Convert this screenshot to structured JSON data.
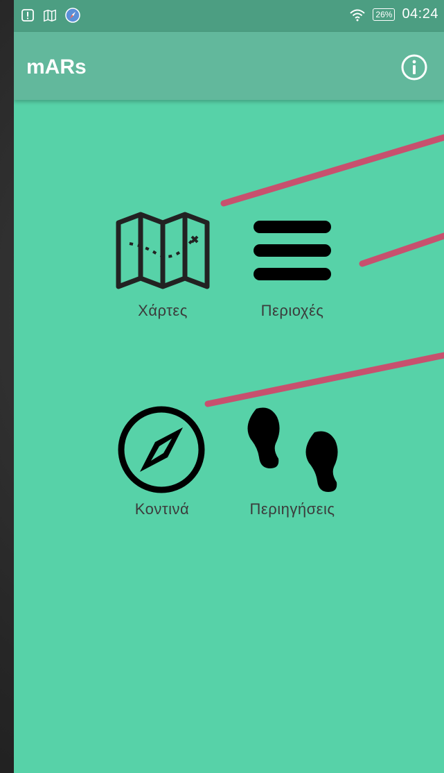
{
  "status_bar": {
    "left_icons": [
      "alert-icon",
      "map-icon",
      "compass-app-icon"
    ],
    "wifi_icon": "wifi-icon",
    "battery": "26%",
    "time": "04:24"
  },
  "app_bar": {
    "title": "mARs",
    "info_icon": "info-icon"
  },
  "menu": {
    "items": [
      {
        "label": "Χάρτες",
        "icon": "map-icon"
      },
      {
        "label": "Περιοχές",
        "icon": "hamburger-list-icon"
      },
      {
        "label": "Κοντινά",
        "icon": "compass-icon"
      },
      {
        "label": "Περιηγήσεις",
        "icon": "footprints-icon"
      }
    ]
  },
  "colors": {
    "screen_background": "#57d2a8",
    "status_bar": "#4c9e82",
    "app_bar": "#62b89c",
    "annotation_line": "#c8506e"
  }
}
